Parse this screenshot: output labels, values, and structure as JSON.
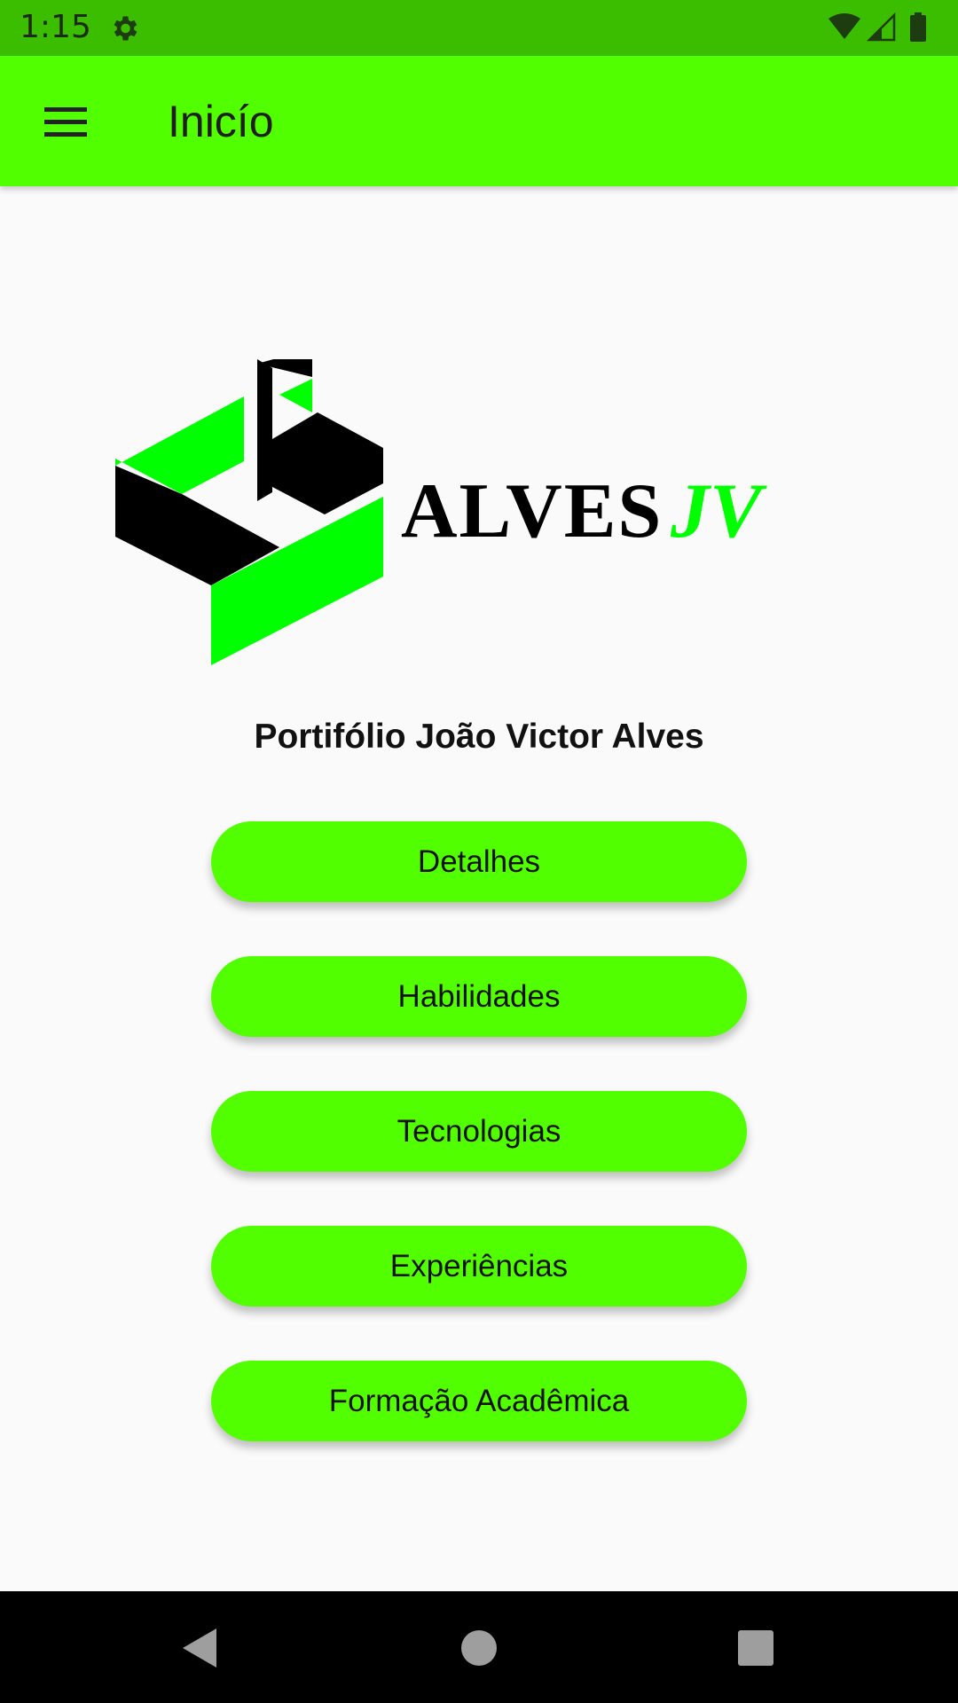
{
  "status_bar": {
    "time": "1:15",
    "icons": [
      "gear-icon",
      "wifi-icon",
      "signal-icon",
      "battery-icon"
    ],
    "color": "#3bbd00"
  },
  "app_bar": {
    "title": "Inicío",
    "menu_icon": "hamburger-menu-icon",
    "color": "#52ff00"
  },
  "logo": {
    "text_main": "ALVES",
    "text_accent": "JV",
    "accent_color": "#00ff00"
  },
  "main": {
    "subtitle": "Portifólio João Victor Alves",
    "buttons": [
      {
        "label": "Detalhes"
      },
      {
        "label": "Habilidades"
      },
      {
        "label": "Tecnologias"
      },
      {
        "label": "Experiências"
      },
      {
        "label": "Formação Acadêmica"
      }
    ],
    "button_color": "#52ff00"
  },
  "system_nav": {
    "icons": [
      "back-icon",
      "home-icon",
      "recents-icon"
    ]
  }
}
